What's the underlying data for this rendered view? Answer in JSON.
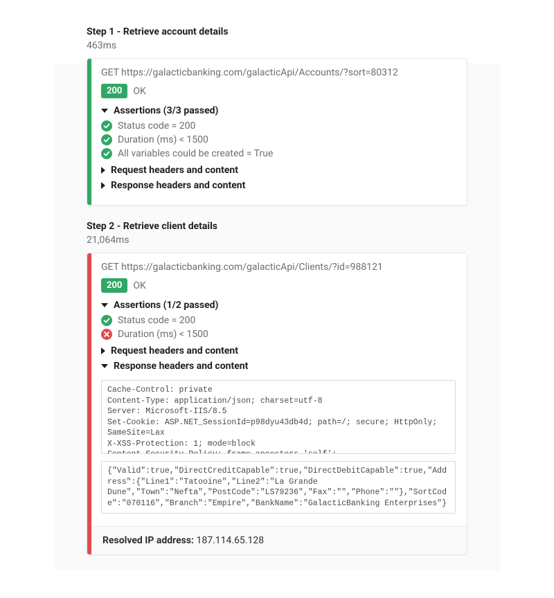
{
  "steps": [
    {
      "title": "Step 1 - Retrieve account details",
      "duration": "463ms",
      "status_border": "pass",
      "request_line": "GET https://galacticbanking.com/galacticApi/Accounts/?sort=80312",
      "status_code": "200",
      "status_text": "OK",
      "assertions_header": "Assertions (3/3 passed)",
      "assertions": [
        {
          "pass": true,
          "text": "Status code = 200"
        },
        {
          "pass": true,
          "text": "Duration (ms) < 1500"
        },
        {
          "pass": true,
          "text": "All variables could be created = True"
        }
      ],
      "request_headers_label": "Request headers and content",
      "response_headers_label": "Response headers and content",
      "response_expanded": false
    },
    {
      "title": "Step 2 - Retrieve client details",
      "duration": "21,064ms",
      "status_border": "fail",
      "request_line": "GET https://galacticbanking.com/galacticApi/Clients/?id=988121",
      "status_code": "200",
      "status_text": "OK",
      "assertions_header": "Assertions (1/2 passed)",
      "assertions": [
        {
          "pass": true,
          "text": "Status code = 200"
        },
        {
          "pass": false,
          "text": "Duration (ms) < 1500"
        }
      ],
      "request_headers_label": "Request headers and content",
      "response_headers_label": "Response headers and content",
      "response_expanded": true,
      "response_headers_text": "Cache-Control: private\nContent-Type: application/json; charset=utf-8\nServer: Microsoft-IIS/8.5\nSet-Cookie: ASP.NET_SessionId=p98dyu43db4d; path=/; secure; HttpOnly; SameSite=Lax\nX-XSS-Protection: 1; mode=block\nContent-Security-Policy: frame-ancestors 'self';",
      "response_body_text": "{\"Valid\":true,\"DirectCreditCapable\":true,\"DirectDebitCapable\":true,\"Address\":{\"Line1\":\"Tatooine\",\"Line2\":\"La Grande Dune\",\"Town\":\"Nefta\",\"PostCode\":\"LS79236\",\"Fax\":\"\",\"Phone\":\"\"},\"SortCode\":\"070116\",\"Branch\":\"Empire\",\"BankName\":\"GalacticBanking Enterprises\"}",
      "resolved_ip_label": "Resolved IP address:",
      "resolved_ip_value": " 187.114.65.128"
    }
  ]
}
